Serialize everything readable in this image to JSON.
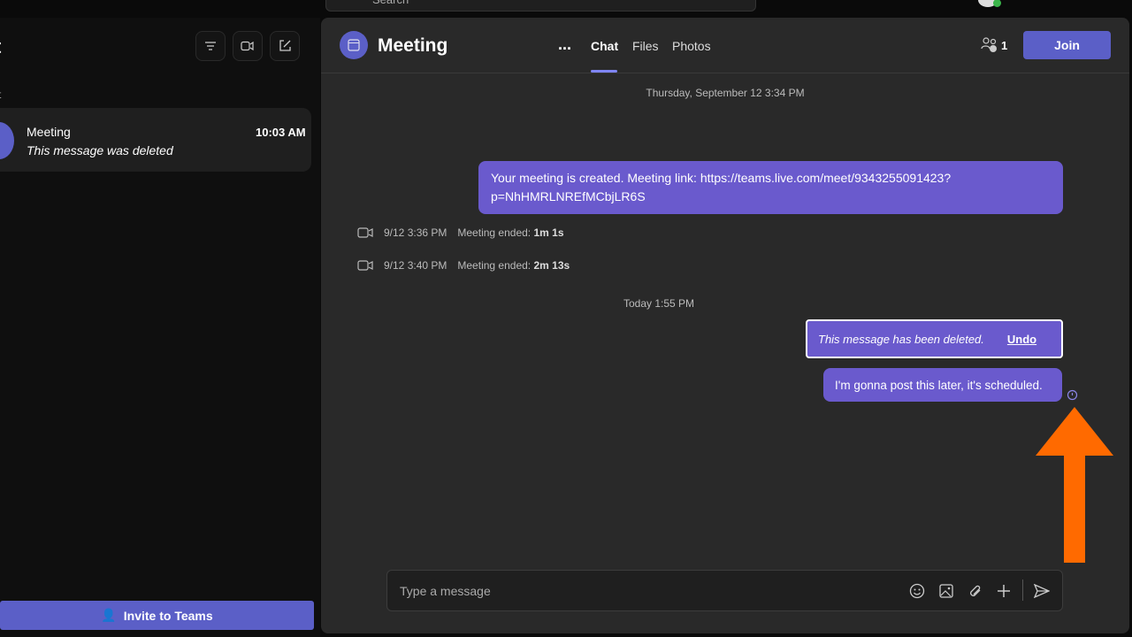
{
  "topbar": {
    "search_placeholder": "Search"
  },
  "sidebar": {
    "title": "t",
    "section": "t",
    "chat_item": {
      "name": "Meeting",
      "time": "10:03 AM",
      "preview": "This message was deleted"
    },
    "invite_label": "Invite to Teams"
  },
  "header": {
    "title": "Meeting",
    "more": "...",
    "tabs": [
      {
        "label": "Chat"
      },
      {
        "label": "Files"
      },
      {
        "label": "Photos"
      }
    ],
    "participants": "1",
    "join_label": "Join"
  },
  "messages": {
    "ts1": "Thursday, September 12 3:34 PM",
    "m1": "Your meeting is created. Meeting link: https://teams.live.com/meet/9343255091423?p=NhHMRLNREfMCbjLR6S",
    "events": [
      {
        "time": "9/12 3:36 PM",
        "label": "Meeting ended:",
        "dur": "1m 1s"
      },
      {
        "time": "9/12 3:40 PM",
        "label": "Meeting ended:",
        "dur": "2m 13s"
      }
    ],
    "ts2": "Today 1:55 PM",
    "deleted": "This message has been deleted.",
    "undo": "Undo",
    "scheduled": "I'm gonna post this later, it's scheduled."
  },
  "compose": {
    "placeholder": "Type a message"
  },
  "colors": {
    "accent": "#5b5fc7",
    "bubble": "#6a5acd",
    "arrow": "#ff6a00"
  }
}
